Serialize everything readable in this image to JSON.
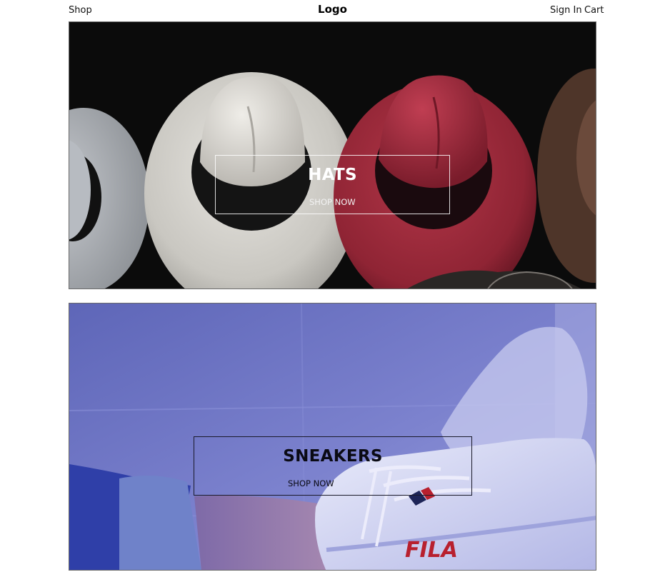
{
  "header": {
    "shop_label": "Shop",
    "logo_text": "Logo",
    "signin_label": "Sign In",
    "cart_label": "Cart"
  },
  "categories": [
    {
      "title": "HATS",
      "cta_label": "SHOP NOW"
    },
    {
      "title": "SNEAKERS",
      "cta_label": "SHOP NOW",
      "brand_text": "FILA"
    }
  ],
  "colors": {
    "hats_background": "#0b0b0b",
    "sneakers_background": "#6f76c4",
    "hat_white": "#d9d8d4",
    "hat_red": "#9e2a3c",
    "hat_brown": "#5a3f33",
    "fila_red": "#b8202e",
    "fila_navy": "#1d2457"
  }
}
